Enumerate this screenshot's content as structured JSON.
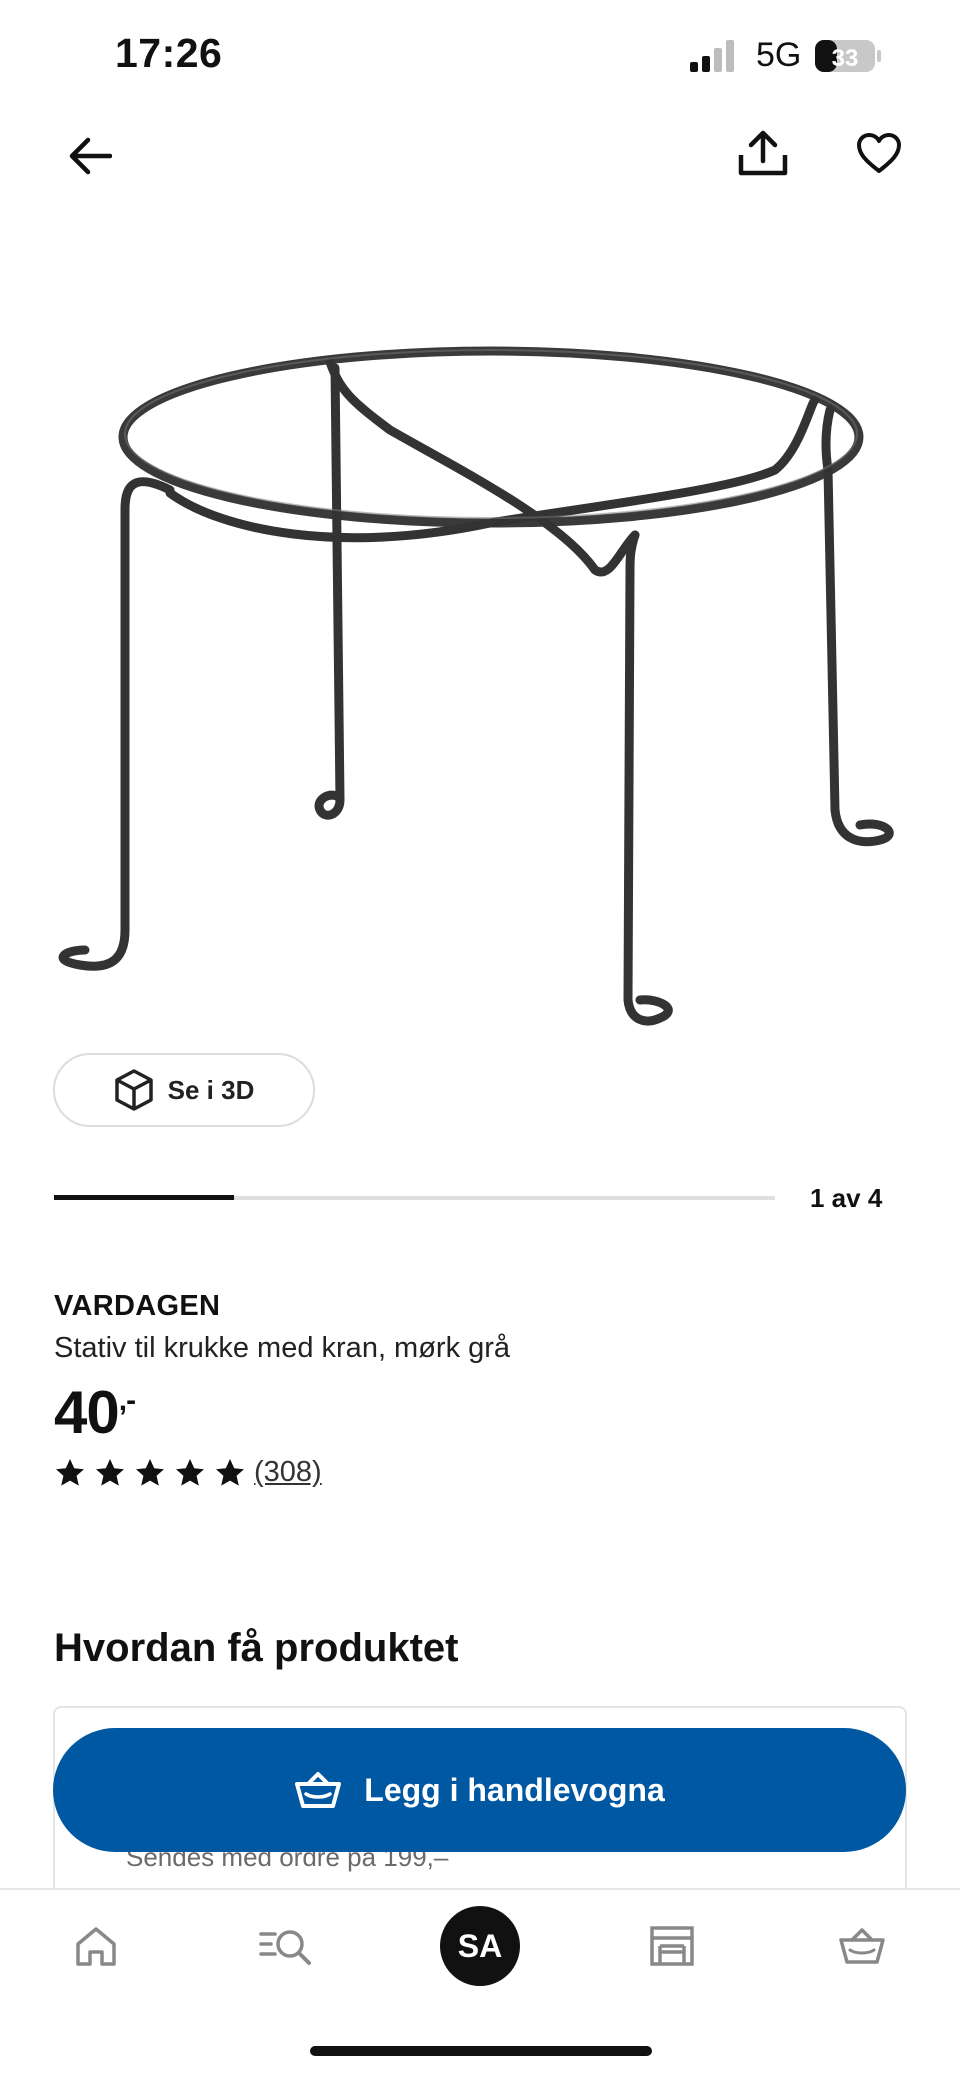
{
  "status_bar": {
    "time": "17:26",
    "network": "5G",
    "battery": "33"
  },
  "gallery": {
    "view_3d_label": "Se i 3D",
    "page_indicator": "1 av 4",
    "progress": 0.25
  },
  "product": {
    "brand": "VARDAGEN",
    "description": "Stativ til krukke med kran, mørk grå",
    "price": "40",
    "price_suffix": ",-",
    "rating": 5,
    "review_count": "(308)"
  },
  "delivery": {
    "heading": "Hvordan få produktet",
    "partial_note": "Sendes med ordre på 199,–"
  },
  "cta": {
    "add_to_cart_label": "Legg i handlevogna"
  },
  "bottom_nav": {
    "items": [
      "home-icon",
      "search-icon",
      "account",
      "store-icon",
      "cart-icon"
    ],
    "avatar_initials": "SA"
  },
  "colors": {
    "brand_blue": "#0058a3",
    "text": "#111111"
  }
}
